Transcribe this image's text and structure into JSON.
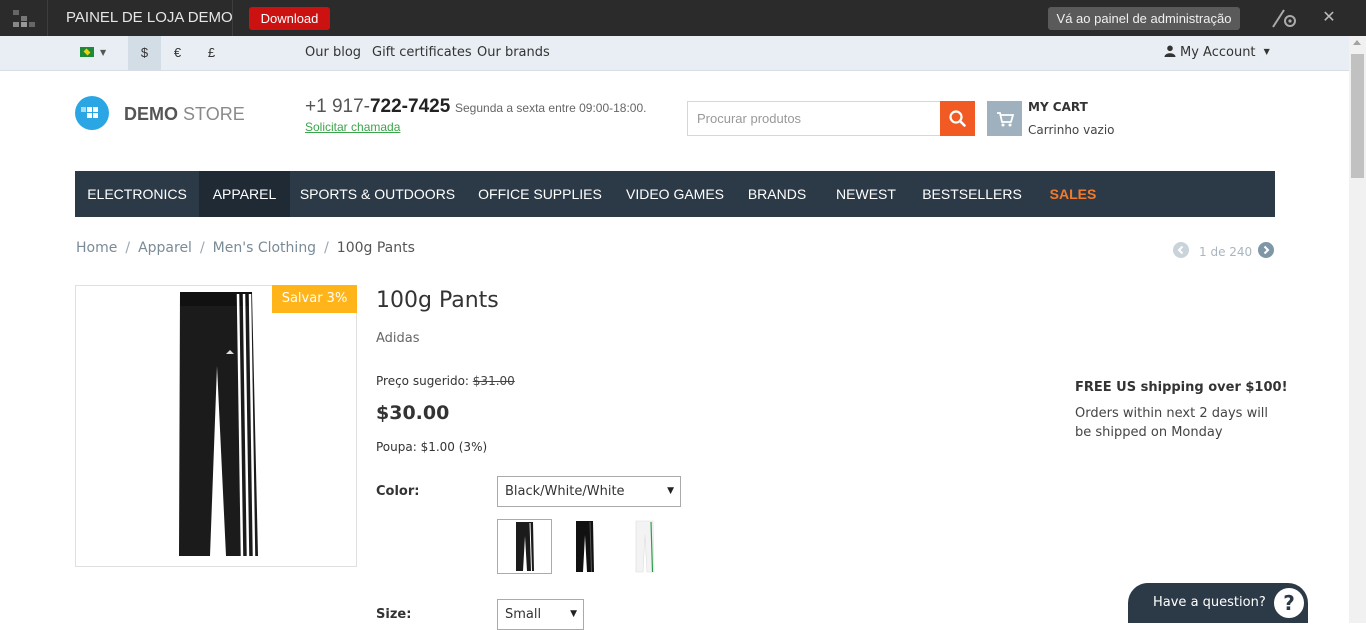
{
  "admin_bar": {
    "title": "PAINEL DE LOJA DEMO",
    "download_label": "Download",
    "admin_panel_label": "Vá ao painel de administração",
    "close_label": "✕"
  },
  "top_strip": {
    "currencies": [
      "$",
      "€",
      "£"
    ],
    "active_currency": "$",
    "links": [
      "Our blog",
      "Gift certificates",
      "Our brands"
    ],
    "my_account_label": "My Account"
  },
  "header": {
    "store_name_bold": "DEMO",
    "store_name_light": "STORE",
    "phone_prefix": "+1 917-",
    "phone_main": "722-7425",
    "hours": "Segunda a sexta entre 09:00-18:00.",
    "callback_link": "Solicitar chamada",
    "search_placeholder": "Procurar produtos",
    "cart_title": "MY CART",
    "cart_status": "Carrinho vazio"
  },
  "nav": {
    "items": [
      "ELECTRONICS",
      "APPAREL",
      "SPORTS & OUTDOORS",
      "OFFICE SUPPLIES",
      "VIDEO GAMES",
      "BRANDS",
      "NEWEST",
      "BESTSELLERS",
      "SALES"
    ],
    "active": "APPAREL",
    "sales_color": "#f47a2a"
  },
  "breadcrumb": [
    "Home",
    "Apparel",
    "Men's Clothing",
    "100g Pants"
  ],
  "pager": {
    "text": "1 de 240"
  },
  "product": {
    "save_badge": "Salvar 3%",
    "title": "100g Pants",
    "brand": "Adidas",
    "list_price_label": "Preço sugerido:",
    "list_price": "$31.00",
    "price": "$30.00",
    "savings": "Poupa: $1.00 (3%)",
    "color_label": "Color:",
    "color_value": "Black/White/White",
    "size_label": "Size:",
    "size_value": "Small",
    "swatches": [
      "Black/White/White",
      "Black/Black",
      "White/Green"
    ]
  },
  "shipping": {
    "title": "FREE US shipping over $100!",
    "text": "Orders within next 2 days will be shipped on Monday"
  },
  "help": {
    "label": "Have a question?",
    "icon": "?"
  },
  "colors": {
    "accent": "#f15a22",
    "nav_bg": "#2c3a47",
    "badge": "#ffb41a",
    "brand_blue": "#2aa6e4",
    "download_red": "#cc1111"
  }
}
